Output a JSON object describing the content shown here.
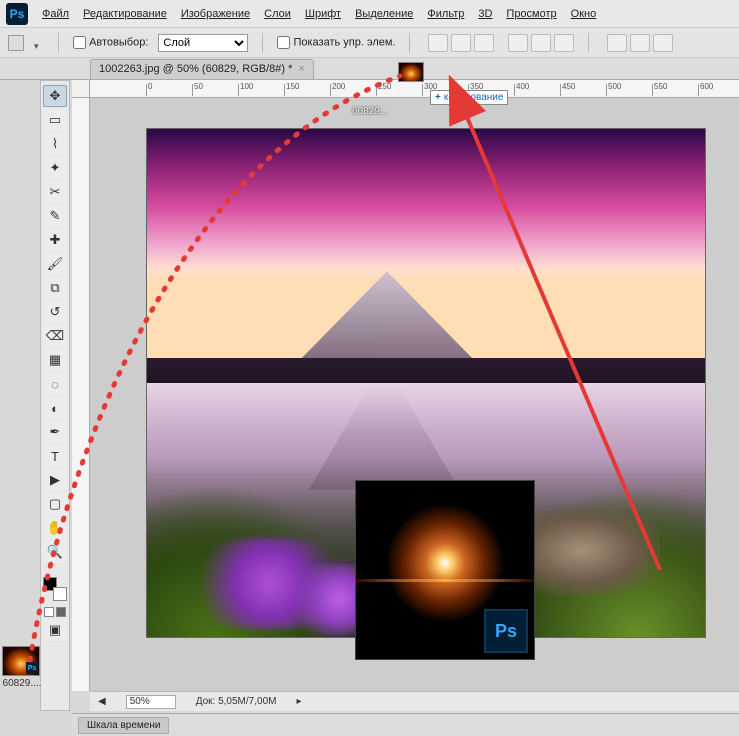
{
  "app": {
    "logo": "Ps"
  },
  "menu": {
    "file": "Файл",
    "edit": "Редактирование",
    "image": "Изображение",
    "layers": "Слои",
    "type": "Шрифт",
    "select": "Выделение",
    "filter": "Фильтр",
    "threeD": "3D",
    "view": "Просмотр",
    "window": "Окно"
  },
  "options": {
    "autoselect_label": "Автовыбор:",
    "layer_select": "Слой",
    "show_controls": "Показать упр. элем."
  },
  "tab": {
    "title": "1002263.jpg @ 50% (60829, RGB/8#) *"
  },
  "drag": {
    "tooltip": "копирование",
    "dim_label": "60829..."
  },
  "ruler": {
    "ticks": [
      "0",
      "50",
      "100",
      "150",
      "200",
      "250",
      "300",
      "350",
      "400",
      "450",
      "500",
      "550",
      "600"
    ]
  },
  "status": {
    "zoom": "50%",
    "doc_label": "Док:",
    "doc_value": "5,05M/7,00M"
  },
  "bottom_panel": {
    "timeline": "Шкала времени"
  },
  "desktop": {
    "thumb_label": "60829...."
  },
  "overlay": {
    "ps": "Ps"
  }
}
